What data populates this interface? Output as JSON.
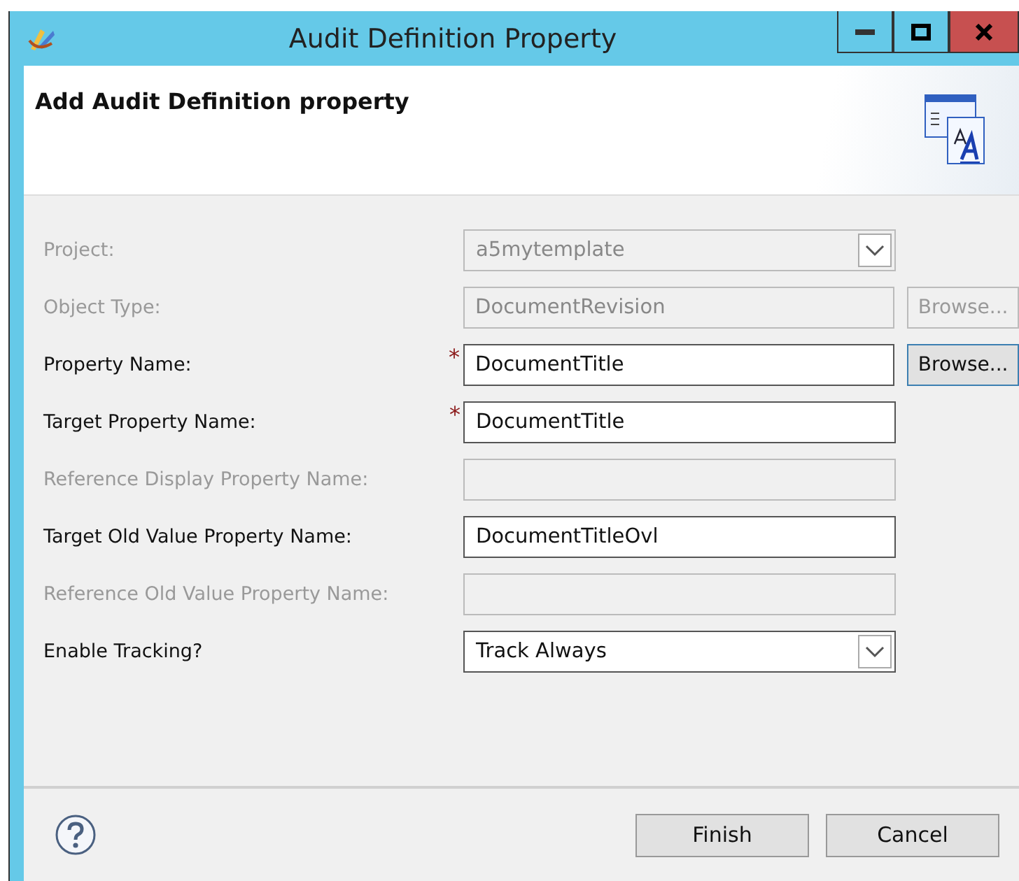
{
  "window": {
    "title": "Audit Definition Property"
  },
  "header": {
    "title": "Add Audit Definition property"
  },
  "fields": [
    {
      "label": "Project:",
      "kind": "combo",
      "value": "a5mytemplate",
      "disabled": true,
      "required": false
    },
    {
      "label": "Object Type:",
      "kind": "text",
      "value": "DocumentRevision",
      "disabled": true,
      "required": false,
      "browse": {
        "label": "Browse...",
        "disabled": true
      }
    },
    {
      "label": "Property Name:",
      "kind": "text",
      "value": "DocumentTitle",
      "disabled": false,
      "required": true,
      "browse": {
        "label": "Browse...",
        "disabled": false
      }
    },
    {
      "label": "Target Property Name:",
      "kind": "text",
      "value": "DocumentTitle",
      "disabled": false,
      "required": true
    },
    {
      "label": "Reference Display Property Name:",
      "kind": "text",
      "disabled": true,
      "required": false
    },
    {
      "label": "Target Old Value Property Name:",
      "kind": "text",
      "value": "DocumentTitleOvl",
      "disabled": false,
      "required": false
    },
    {
      "label": "Reference Old Value Property Name:",
      "kind": "text",
      "disabled": true,
      "required": false
    },
    {
      "label": "Enable Tracking?",
      "kind": "combo",
      "value": "Track Always",
      "disabled": false,
      "required": false
    }
  ],
  "required_mark": "*",
  "buttons": [
    "Finish",
    "Cancel"
  ]
}
